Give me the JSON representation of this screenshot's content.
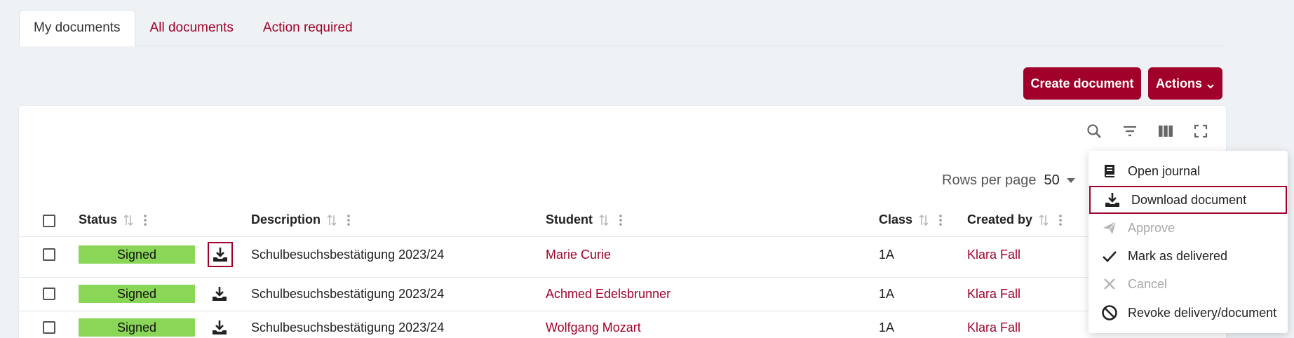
{
  "tabs": [
    {
      "label": "My documents",
      "active": true
    },
    {
      "label": "All documents",
      "active": false
    },
    {
      "label": "Action required",
      "active": false
    }
  ],
  "toolbar": {
    "create_label": "Create document",
    "actions_label": "Actions"
  },
  "table_tools": [
    "search-icon",
    "filter-icon",
    "columns-icon",
    "fullscreen-icon"
  ],
  "pagination": {
    "rows_per_page_label": "Rows per page",
    "rows_per_page_value": "50"
  },
  "columns": {
    "status": "Status",
    "description": "Description",
    "student": "Student",
    "class": "Class",
    "created_by": "Created by"
  },
  "rows": [
    {
      "status": "Signed",
      "description": "Schulbesuchsbestätigung 2023/24",
      "student": "Marie Curie",
      "class": "1A",
      "created_by": "Klara Fall"
    },
    {
      "status": "Signed",
      "description": "Schulbesuchsbestätigung 2023/24",
      "student": "Achmed Edelsbrunner",
      "class": "1A",
      "created_by": "Klara Fall"
    },
    {
      "status": "Signed",
      "description": "Schulbesuchsbestätigung 2023/24",
      "student": "Wolfgang Mozart",
      "class": "1A",
      "created_by": "Klara Fall"
    }
  ],
  "menu": {
    "items": [
      {
        "label": "Open journal",
        "icon": "book-icon",
        "disabled": false
      },
      {
        "label": "Download document",
        "icon": "download-icon",
        "disabled": false,
        "selected": true
      },
      {
        "label": "Approve",
        "icon": "send-icon",
        "disabled": true
      },
      {
        "label": "Mark as delivered",
        "icon": "check-icon",
        "disabled": false
      },
      {
        "label": "Cancel",
        "icon": "close-icon",
        "disabled": true
      },
      {
        "label": "Revoke delivery/document",
        "icon": "block-icon",
        "disabled": false
      }
    ]
  },
  "colors": {
    "brand": "#a0002a",
    "status_signed": "#8ad657",
    "background": "#eff2f5"
  }
}
